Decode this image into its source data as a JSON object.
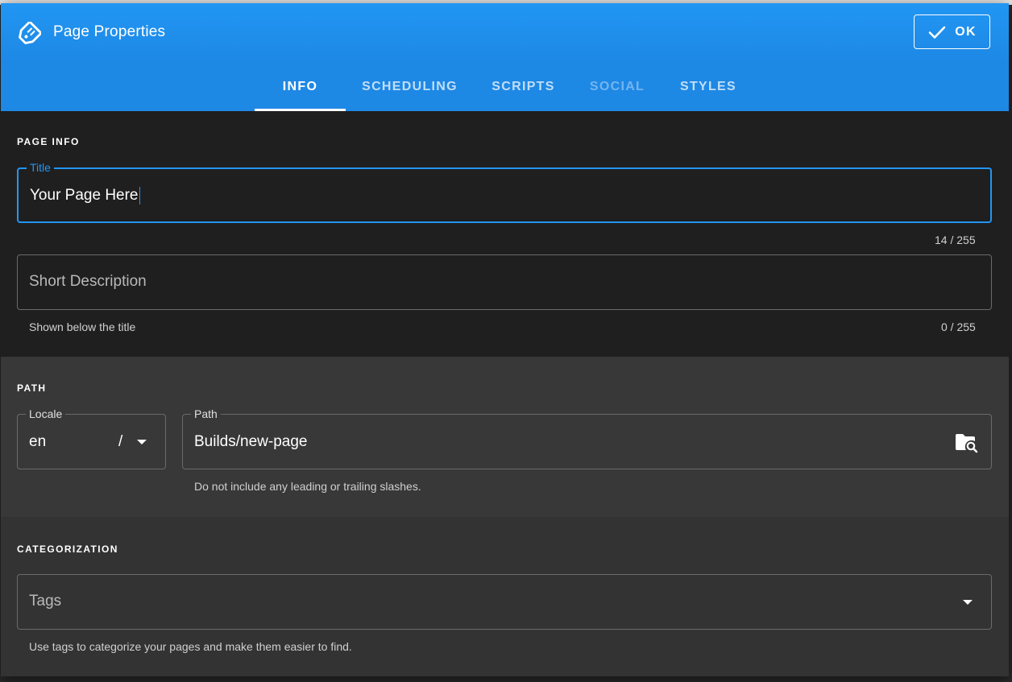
{
  "dialog": {
    "title": "Page Properties",
    "ok_label": "OK"
  },
  "tabs": [
    {
      "label": "INFO",
      "state": "active"
    },
    {
      "label": "SCHEDULING",
      "state": "normal"
    },
    {
      "label": "SCRIPTS",
      "state": "normal"
    },
    {
      "label": "SOCIAL",
      "state": "disabled"
    },
    {
      "label": "STYLES",
      "state": "normal"
    }
  ],
  "page_info": {
    "section_title": "PAGE INFO",
    "title_field": {
      "label": "Title",
      "value": "Your Page Here",
      "counter": "14 / 255"
    },
    "description_field": {
      "placeholder": "Short Description",
      "hint": "Shown below the title",
      "counter": "0 / 255"
    }
  },
  "path": {
    "section_title": "PATH",
    "locale": {
      "label": "Locale",
      "value": "en",
      "separator": "/"
    },
    "path_field": {
      "label": "Path",
      "value": "Builds/new-page",
      "hint": "Do not include any leading or trailing slashes."
    }
  },
  "categorization": {
    "section_title": "CATEGORIZATION",
    "tags": {
      "placeholder": "Tags",
      "hint": "Use tags to categorize your pages and make them easier to find."
    }
  },
  "colors": {
    "header": "#2196f3",
    "tabs_bar": "#1e88e5",
    "focus": "#2196f3",
    "dialog_bg": "#1f1f1f"
  },
  "icons": {
    "header": "tag-icon",
    "ok": "check-icon",
    "locale_dropdown": "chevron-down-icon",
    "path_browse": "folder-search-icon",
    "tags_dropdown": "chevron-down-icon"
  }
}
